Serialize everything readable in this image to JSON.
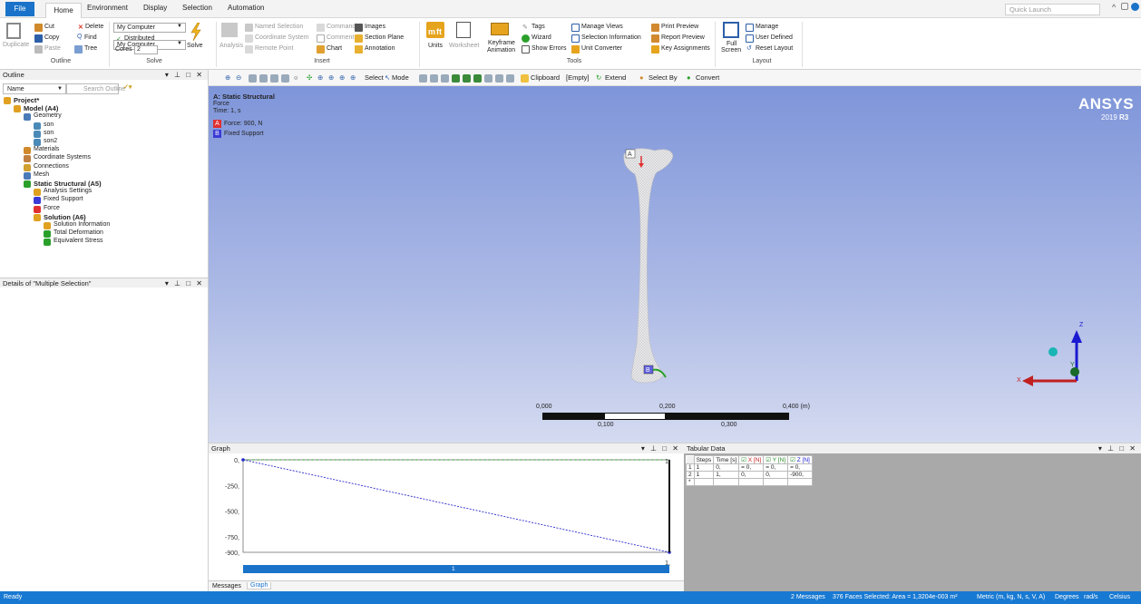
{
  "menu": {
    "file": "File",
    "tabs": [
      "Home",
      "Environment",
      "Display",
      "Selection",
      "Automation"
    ],
    "quick_launch_placeholder": "Quick Launch"
  },
  "ribbon": {
    "outline": {
      "duplicate": "Duplicate",
      "cut": "Cut",
      "copy": "Copy",
      "paste": "Paste",
      "delete": "Delete",
      "find": "Find",
      "tree": "Tree",
      "group": "Outline"
    },
    "solve": {
      "computer": "My Computer",
      "distributed": "Distributed",
      "cores_label": "Cores",
      "cores_value": "2",
      "solve": "Solve",
      "group": "Solve"
    },
    "insert": {
      "analysis": "Analysis",
      "named_selection": "Named Selection",
      "coordinate_system": "Coordinate System",
      "remote_point": "Remote Point",
      "commands": "Commands",
      "comment": "Comment",
      "chart": "Chart",
      "images": "Images",
      "section_plane": "Section Plane",
      "annotation": "Annotation",
      "group": "Insert"
    },
    "tools": {
      "units": "Units",
      "worksheet": "Worksheet",
      "keyframe": "Keyframe",
      "animation": "Animation",
      "tags": "Tags",
      "wizard": "Wizard",
      "show_errors": "Show Errors",
      "manage_views": "Manage Views",
      "selection_info": "Selection Information",
      "unit_converter": "Unit Converter",
      "print_preview": "Print Preview",
      "report_preview": "Report Preview",
      "key_assignments": "Key Assignments",
      "group": "Tools"
    },
    "layout": {
      "full": "Full",
      "screen": "Screen",
      "manage": "Manage",
      "user_defined": "User Defined",
      "reset_layout": "Reset Layout",
      "group": "Layout"
    }
  },
  "toolbar": {
    "select": "Select",
    "mode": "Mode",
    "clipboard": "Clipboard",
    "empty": "[Empty]",
    "extend": "Extend",
    "select_by": "Select By",
    "convert": "Convert"
  },
  "outline": {
    "title": "Outline",
    "name_col": "Name",
    "search_placeholder": "Search Outline",
    "items": [
      {
        "label": "Project*",
        "bold": true,
        "indent": 0
      },
      {
        "label": "Model (A4)",
        "bold": true,
        "indent": 1
      },
      {
        "label": "Geometry",
        "bold": false,
        "indent": 2
      },
      {
        "label": "son",
        "bold": false,
        "indent": 3
      },
      {
        "label": "son",
        "bold": false,
        "indent": 3
      },
      {
        "label": "son2",
        "bold": false,
        "indent": 3
      },
      {
        "label": "Materials",
        "bold": false,
        "indent": 2
      },
      {
        "label": "Coordinate Systems",
        "bold": false,
        "indent": 2
      },
      {
        "label": "Connections",
        "bold": false,
        "indent": 2
      },
      {
        "label": "Mesh",
        "bold": false,
        "indent": 2
      },
      {
        "label": "Static Structural (A5)",
        "bold": true,
        "indent": 2
      },
      {
        "label": "Analysis Settings",
        "bold": false,
        "indent": 3
      },
      {
        "label": "Fixed Support",
        "bold": false,
        "indent": 3
      },
      {
        "label": "Force",
        "bold": false,
        "indent": 3
      },
      {
        "label": "Solution (A6)",
        "bold": true,
        "indent": 3
      },
      {
        "label": "Solution Information",
        "bold": false,
        "indent": 4
      },
      {
        "label": "Total Deformation",
        "bold": false,
        "indent": 4
      },
      {
        "label": "Equivalent Stress",
        "bold": false,
        "indent": 4
      }
    ]
  },
  "details": {
    "title": "Details of \"Multiple Selection\""
  },
  "viewport": {
    "analysis_title": "A: Static Structural",
    "result": "Force",
    "time": "Time: 1, s",
    "legend_a": "Force: 900, N",
    "legend_b": "Fixed Support",
    "marker_a": "A",
    "marker_b": "B",
    "brand": "ANSYS",
    "version_prefix": "2019 ",
    "version_suffix": "R3",
    "scale_top": [
      "0,000",
      "0,200",
      "0,400 (m)"
    ],
    "scale_bottom": [
      "0,100",
      "0,300"
    ],
    "axis_x": "X",
    "axis_y": "Y",
    "axis_z": "Z"
  },
  "graph": {
    "title": "Graph",
    "y_ticks": [
      "0,",
      "-250,",
      "-500,",
      "-750,",
      "-900,"
    ],
    "y_values": [
      0,
      -250,
      -500,
      -750,
      -900
    ],
    "top_right_label": "1,",
    "bottom_right_label": "1,",
    "timeline_label": "1",
    "tabs": [
      "Messages",
      "Graph"
    ]
  },
  "chart_data": {
    "type": "line",
    "x": [
      0,
      1
    ],
    "series": [
      {
        "name": "Z [N]",
        "values": [
          0,
          -900
        ]
      }
    ],
    "ylim": [
      -900,
      0
    ],
    "yticks": [
      0,
      -250,
      -500,
      -750,
      -900
    ]
  },
  "tabular": {
    "title": "Tabular Data",
    "headers": [
      "Steps",
      "Time [s]",
      "X [N]",
      "Y [N]",
      "Z [N]"
    ],
    "rows": [
      [
        "1",
        "1",
        "0,",
        "= 0,",
        "= 0,",
        "= 0,"
      ],
      [
        "2",
        "1",
        "1,",
        "0,",
        "0,",
        "-900,"
      ]
    ],
    "new_row_marker": "*"
  },
  "status": {
    "ready": "Ready",
    "messages": "2 Messages",
    "selection": "376 Faces Selected: Area = 1,3204e-003 m²",
    "units": "Metric (m, kg, N, s, V, A)",
    "degrees": "Degrees",
    "rads": "rad/s",
    "temp": "Celsius"
  },
  "colors": {
    "accent": "#1879d2",
    "force": "#e03030",
    "support": "#3a3ad6",
    "green": "#2aa02a"
  }
}
